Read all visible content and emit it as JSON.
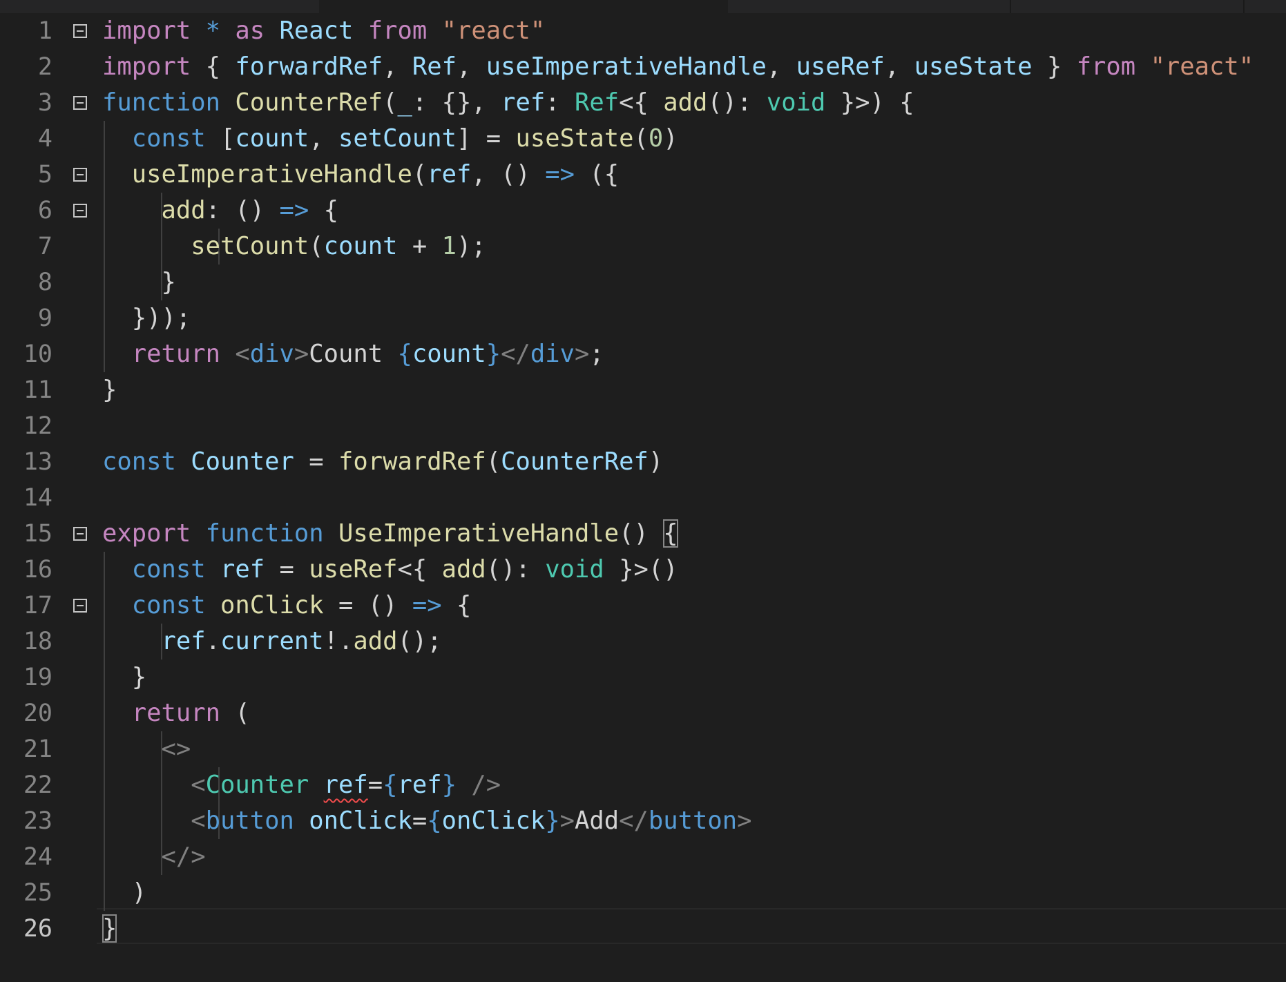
{
  "colors": {
    "background": "#1e1e1e",
    "keyword_control": "#c586c0",
    "keyword_storage": "#569cd6",
    "function": "#dcdcaa",
    "variable": "#9cdcfe",
    "type": "#4ec9b0",
    "string": "#ce9178",
    "number": "#b5cea8",
    "tag": "#569cd6",
    "punctuation": "#d4d4d4",
    "line_number": "#858585",
    "error_squiggle": "#f14c4c"
  },
  "editor": {
    "current_line": 26,
    "line_numbers": [
      "1",
      "2",
      "3",
      "4",
      "5",
      "6",
      "7",
      "8",
      "9",
      "10",
      "11",
      "12",
      "13",
      "14",
      "15",
      "16",
      "17",
      "18",
      "19",
      "20",
      "21",
      "22",
      "23",
      "24",
      "25",
      "26"
    ],
    "lines": [
      [
        {
          "t": "import",
          "c": "kw"
        },
        {
          "t": " ",
          "c": "txt"
        },
        {
          "t": "*",
          "c": "st"
        },
        {
          "t": " ",
          "c": "txt"
        },
        {
          "t": "as",
          "c": "kw"
        },
        {
          "t": " ",
          "c": "txt"
        },
        {
          "t": "React",
          "c": "var"
        },
        {
          "t": " ",
          "c": "txt"
        },
        {
          "t": "from",
          "c": "kw"
        },
        {
          "t": " ",
          "c": "txt"
        },
        {
          "t": "\"react\"",
          "c": "str"
        }
      ],
      [
        {
          "t": "import",
          "c": "kw"
        },
        {
          "t": " { ",
          "c": "txt"
        },
        {
          "t": "forwardRef",
          "c": "var"
        },
        {
          "t": ", ",
          "c": "txt"
        },
        {
          "t": "Ref",
          "c": "var"
        },
        {
          "t": ", ",
          "c": "txt"
        },
        {
          "t": "useImperativeHandle",
          "c": "var"
        },
        {
          "t": ", ",
          "c": "txt"
        },
        {
          "t": "useRef",
          "c": "var"
        },
        {
          "t": ", ",
          "c": "txt"
        },
        {
          "t": "useState",
          "c": "var"
        },
        {
          "t": " } ",
          "c": "txt"
        },
        {
          "t": "from",
          "c": "kw"
        },
        {
          "t": " ",
          "c": "txt"
        },
        {
          "t": "\"react\"",
          "c": "str"
        }
      ],
      [
        {
          "t": "function",
          "c": "st"
        },
        {
          "t": " ",
          "c": "txt"
        },
        {
          "t": "CounterRef",
          "c": "fn"
        },
        {
          "t": "(",
          "c": "txt"
        },
        {
          "t": "_",
          "c": "var"
        },
        {
          "t": ": {}, ",
          "c": "txt"
        },
        {
          "t": "ref",
          "c": "var"
        },
        {
          "t": ": ",
          "c": "txt"
        },
        {
          "t": "Ref",
          "c": "type"
        },
        {
          "t": "<{ ",
          "c": "txt"
        },
        {
          "t": "add",
          "c": "fn"
        },
        {
          "t": "(): ",
          "c": "txt"
        },
        {
          "t": "void",
          "c": "type"
        },
        {
          "t": " }>) {",
          "c": "txt"
        }
      ],
      [
        {
          "t": "  ",
          "c": "txt"
        },
        {
          "t": "const",
          "c": "st"
        },
        {
          "t": " [",
          "c": "txt"
        },
        {
          "t": "count",
          "c": "var"
        },
        {
          "t": ", ",
          "c": "txt"
        },
        {
          "t": "setCount",
          "c": "var"
        },
        {
          "t": "] = ",
          "c": "txt"
        },
        {
          "t": "useState",
          "c": "fn"
        },
        {
          "t": "(",
          "c": "txt"
        },
        {
          "t": "0",
          "c": "num"
        },
        {
          "t": ")",
          "c": "txt"
        }
      ],
      [
        {
          "t": "  ",
          "c": "txt"
        },
        {
          "t": "useImperativeHandle",
          "c": "fn"
        },
        {
          "t": "(",
          "c": "txt"
        },
        {
          "t": "ref",
          "c": "var"
        },
        {
          "t": ", () ",
          "c": "txt"
        },
        {
          "t": "=>",
          "c": "st"
        },
        {
          "t": " ({",
          "c": "txt"
        }
      ],
      [
        {
          "t": "    ",
          "c": "txt"
        },
        {
          "t": "add",
          "c": "fn"
        },
        {
          "t": ": () ",
          "c": "txt"
        },
        {
          "t": "=>",
          "c": "st"
        },
        {
          "t": " {",
          "c": "txt"
        }
      ],
      [
        {
          "t": "      ",
          "c": "txt"
        },
        {
          "t": "setCount",
          "c": "fn"
        },
        {
          "t": "(",
          "c": "txt"
        },
        {
          "t": "count",
          "c": "var"
        },
        {
          "t": " + ",
          "c": "txt"
        },
        {
          "t": "1",
          "c": "num"
        },
        {
          "t": ");",
          "c": "txt"
        }
      ],
      [
        {
          "t": "    }",
          "c": "txt"
        }
      ],
      [
        {
          "t": "  }));",
          "c": "txt"
        }
      ],
      [
        {
          "t": "  ",
          "c": "txt"
        },
        {
          "t": "return",
          "c": "kw"
        },
        {
          "t": " ",
          "c": "txt"
        },
        {
          "t": "<",
          "c": "ang"
        },
        {
          "t": "div",
          "c": "tag"
        },
        {
          "t": ">",
          "c": "ang"
        },
        {
          "t": "Count ",
          "c": "txt"
        },
        {
          "t": "{",
          "c": "st"
        },
        {
          "t": "count",
          "c": "var"
        },
        {
          "t": "}",
          "c": "st"
        },
        {
          "t": "</",
          "c": "ang"
        },
        {
          "t": "div",
          "c": "tag"
        },
        {
          "t": ">",
          "c": "ang"
        },
        {
          "t": ";",
          "c": "txt"
        }
      ],
      [
        {
          "t": "}",
          "c": "txt"
        }
      ],
      [],
      [
        {
          "t": "const",
          "c": "st"
        },
        {
          "t": " ",
          "c": "txt"
        },
        {
          "t": "Counter",
          "c": "var"
        },
        {
          "t": " = ",
          "c": "txt"
        },
        {
          "t": "forwardRef",
          "c": "fn"
        },
        {
          "t": "(",
          "c": "txt"
        },
        {
          "t": "CounterRef",
          "c": "var"
        },
        {
          "t": ")",
          "c": "txt"
        }
      ],
      [],
      [
        {
          "t": "export",
          "c": "kw"
        },
        {
          "t": " ",
          "c": "txt"
        },
        {
          "t": "function",
          "c": "st"
        },
        {
          "t": " ",
          "c": "txt"
        },
        {
          "t": "UseImperativeHandle",
          "c": "fn"
        },
        {
          "t": "() ",
          "c": "txt"
        },
        {
          "t": "{",
          "c": "txt",
          "cls": "bracket-match"
        }
      ],
      [
        {
          "t": "  ",
          "c": "txt"
        },
        {
          "t": "const",
          "c": "st"
        },
        {
          "t": " ",
          "c": "txt"
        },
        {
          "t": "ref",
          "c": "var"
        },
        {
          "t": " = ",
          "c": "txt"
        },
        {
          "t": "useRef",
          "c": "fn"
        },
        {
          "t": "<{ ",
          "c": "txt"
        },
        {
          "t": "add",
          "c": "fn"
        },
        {
          "t": "(): ",
          "c": "txt"
        },
        {
          "t": "void",
          "c": "type"
        },
        {
          "t": " }>()",
          "c": "txt"
        }
      ],
      [
        {
          "t": "  ",
          "c": "txt"
        },
        {
          "t": "const",
          "c": "st"
        },
        {
          "t": " ",
          "c": "txt"
        },
        {
          "t": "onClick",
          "c": "fn"
        },
        {
          "t": " = () ",
          "c": "txt"
        },
        {
          "t": "=>",
          "c": "st"
        },
        {
          "t": " {",
          "c": "txt"
        }
      ],
      [
        {
          "t": "    ",
          "c": "txt"
        },
        {
          "t": "ref",
          "c": "var"
        },
        {
          "t": ".",
          "c": "txt"
        },
        {
          "t": "current",
          "c": "var"
        },
        {
          "t": "!.",
          "c": "txt"
        },
        {
          "t": "add",
          "c": "fn"
        },
        {
          "t": "();",
          "c": "txt"
        }
      ],
      [
        {
          "t": "  }",
          "c": "txt"
        }
      ],
      [
        {
          "t": "  ",
          "c": "txt"
        },
        {
          "t": "return",
          "c": "kw"
        },
        {
          "t": " (",
          "c": "txt"
        }
      ],
      [
        {
          "t": "    ",
          "c": "txt"
        },
        {
          "t": "<>",
          "c": "ang"
        }
      ],
      [
        {
          "t": "      ",
          "c": "txt"
        },
        {
          "t": "<",
          "c": "ang"
        },
        {
          "t": "Counter",
          "c": "type"
        },
        {
          "t": " ",
          "c": "txt"
        },
        {
          "t": "ref",
          "c": "var",
          "cls": "squiggle"
        },
        {
          "t": "=",
          "c": "txt"
        },
        {
          "t": "{",
          "c": "st"
        },
        {
          "t": "ref",
          "c": "var"
        },
        {
          "t": "}",
          "c": "st"
        },
        {
          "t": " />",
          "c": "ang"
        }
      ],
      [
        {
          "t": "      ",
          "c": "txt"
        },
        {
          "t": "<",
          "c": "ang"
        },
        {
          "t": "button",
          "c": "tag"
        },
        {
          "t": " ",
          "c": "txt"
        },
        {
          "t": "onClick",
          "c": "var"
        },
        {
          "t": "=",
          "c": "txt"
        },
        {
          "t": "{",
          "c": "st"
        },
        {
          "t": "onClick",
          "c": "var"
        },
        {
          "t": "}",
          "c": "st"
        },
        {
          "t": ">",
          "c": "ang"
        },
        {
          "t": "Add",
          "c": "txt"
        },
        {
          "t": "</",
          "c": "ang"
        },
        {
          "t": "button",
          "c": "tag"
        },
        {
          "t": ">",
          "c": "ang"
        }
      ],
      [
        {
          "t": "    ",
          "c": "txt"
        },
        {
          "t": "</>",
          "c": "ang"
        }
      ],
      [
        {
          "t": "  )",
          "c": "txt"
        }
      ],
      [
        {
          "t": "}",
          "c": "txt",
          "cls": "bracket-match"
        },
        {
          "cursor": true
        }
      ]
    ]
  }
}
